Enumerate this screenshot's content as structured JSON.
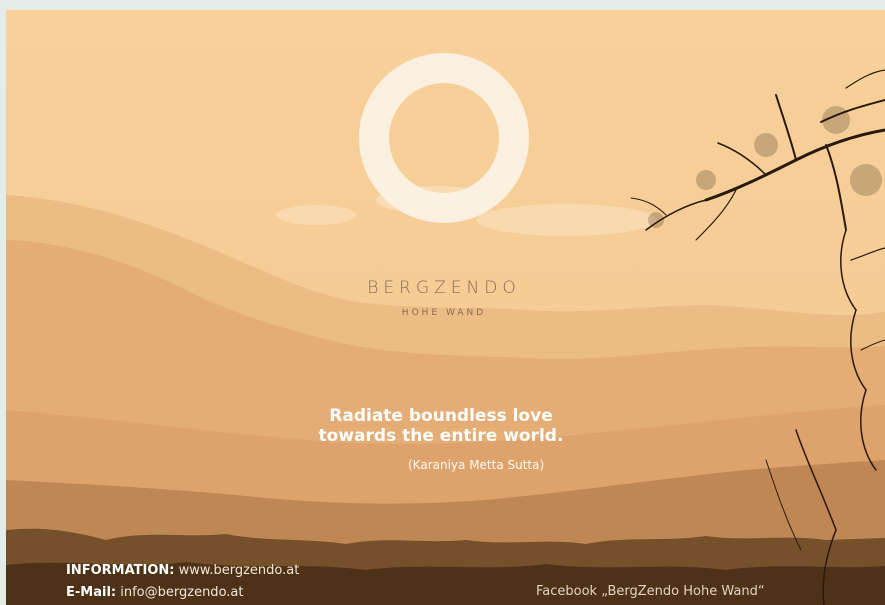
{
  "brand": {
    "name": "BERGZENDO",
    "subtitle": "HOHE WAND"
  },
  "quote": {
    "line1": "Radiate boundless love",
    "line2": "towards the entire world.",
    "source": "(Karaniya Metta Sutta)"
  },
  "footer": {
    "info_label": "INFORMATION:",
    "info_value": "www.bergzendo.at",
    "email_label": "E-Mail:",
    "email_value": "info@bergzendo.at",
    "facebook": "Facebook „BergZendo Hohe Wand“"
  },
  "colors": {
    "sky": "#f6cd92",
    "accent_text": "#8a6a55",
    "logo_ring": "#fbf1e4"
  }
}
